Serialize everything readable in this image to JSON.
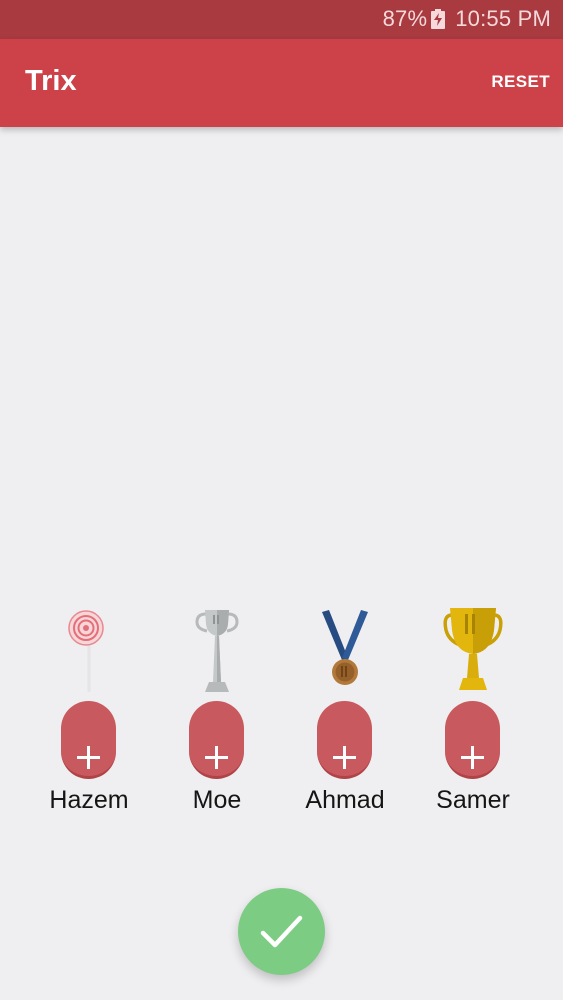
{
  "status_bar": {
    "battery": "87%",
    "time": "10:55 PM"
  },
  "app_bar": {
    "title": "Trix",
    "reset_label": "RESET"
  },
  "players": [
    {
      "name": "Hazem",
      "award_icon": "lollipop-icon",
      "add_label": "+"
    },
    {
      "name": "Moe",
      "award_icon": "silver-trophy-icon",
      "add_label": "+"
    },
    {
      "name": "Ahmad",
      "award_icon": "bronze-medal-icon",
      "add_label": "+"
    },
    {
      "name": "Samer",
      "award_icon": "gold-trophy-icon",
      "add_label": "+"
    }
  ],
  "colors": {
    "status_bar": "#a83a40",
    "app_bar": "#cd4149",
    "add_button": "#c8595e",
    "fab": "#7ccc84",
    "background": "#efeef0"
  }
}
